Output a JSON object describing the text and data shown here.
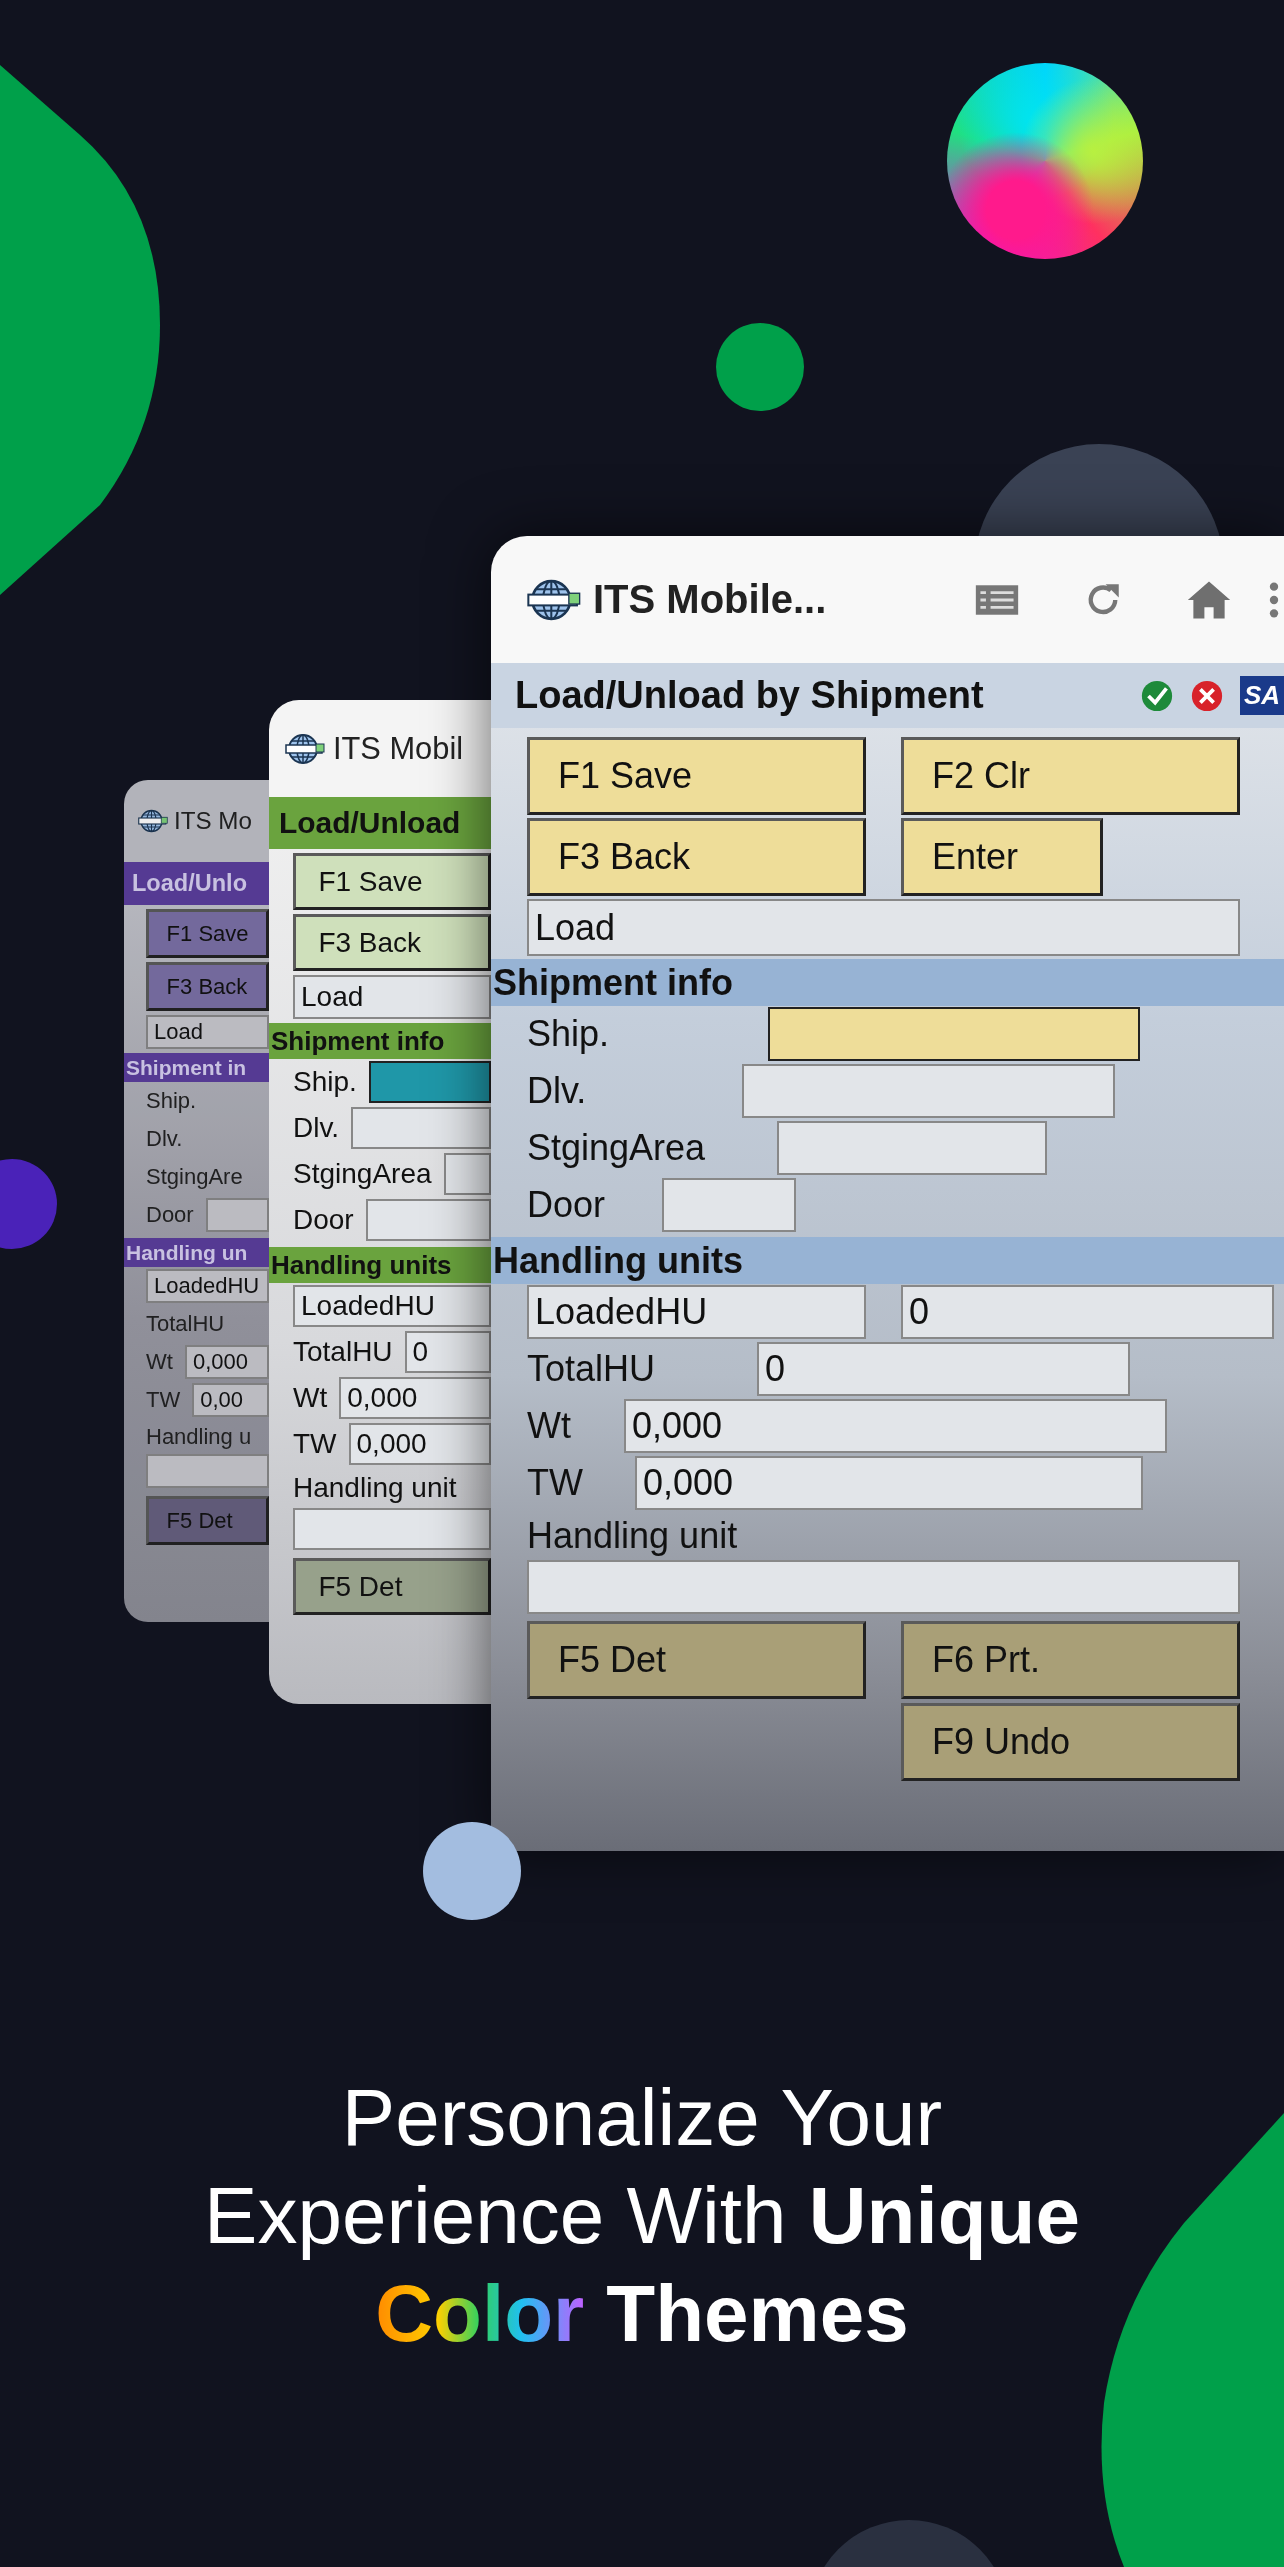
{
  "screens": [
    {
      "kind": "violet",
      "app_title": "ITS Mo",
      "title": "Load/Unlo",
      "color": "#5b3e9c",
      "buttons": [
        [
          "F1 Save"
        ],
        [
          "F3 Back"
        ]
      ],
      "mode_field": "Load",
      "sections": [
        {
          "heading": "Shipment in",
          "rows": [
            {
              "kind": "field",
              "label": "Ship."
            },
            {
              "kind": "field",
              "label": "Dlv."
            },
            {
              "kind": "field",
              "label": "StgingAre"
            },
            {
              "kind": "field",
              "label": "Door",
              "field": {
                "focused": false
              }
            }
          ]
        },
        {
          "heading": "Handling un",
          "rows": [
            {
              "kind": "boxed",
              "label": "LoadedHU"
            },
            {
              "kind": "field",
              "label": "TotalHU"
            },
            {
              "kind": "field",
              "label": "Wt",
              "field": {
                "value": "0,000",
                "focused": false
              }
            },
            {
              "kind": "field",
              "label": "TW",
              "field": {
                "value": "0,00",
                "focused": false
              }
            },
            {
              "kind": "stacked",
              "label": "Handling u",
              "field": {
                "focused": false
              }
            }
          ]
        }
      ],
      "footer_buttons": [
        [
          "F5 Det"
        ]
      ]
    },
    {
      "kind": "green",
      "app_title": "ITS Mobil",
      "title": "Load/Unload",
      "color": "#6aa33e",
      "buttons": [
        [
          "F1 Save"
        ],
        [
          "F3 Back"
        ]
      ],
      "mode_field": "Load",
      "sections": [
        {
          "heading": "Shipment info",
          "rows": [
            {
              "kind": "field",
              "label": "Ship.",
              "field": {
                "focused": true
              }
            },
            {
              "kind": "field",
              "label": "Dlv.",
              "field": {
                "focused": false
              }
            },
            {
              "kind": "field",
              "label": "StgingArea",
              "field": {
                "focused": false
              }
            },
            {
              "kind": "field",
              "label": "Door",
              "field": {
                "focused": false
              }
            }
          ]
        },
        {
          "heading": "Handling units",
          "rows": [
            {
              "kind": "boxed",
              "label": "LoadedHU"
            },
            {
              "kind": "field",
              "label": "TotalHU",
              "field": {
                "value": "0",
                "focused": false
              }
            },
            {
              "kind": "field",
              "label": "Wt",
              "field": {
                "value": "0,000",
                "focused": false
              }
            },
            {
              "kind": "field",
              "label": "TW",
              "field": {
                "value": "0,000",
                "focused": false
              }
            },
            {
              "kind": "stacked",
              "label": "Handling unit",
              "field": {
                "focused": false
              }
            }
          ]
        }
      ],
      "footer_buttons": [
        [
          "F5 Det"
        ]
      ]
    },
    {
      "kind": "classic",
      "app_title": "ITS Mobile...",
      "title": "Load/Unload by Shipment",
      "logo_text": "SA",
      "color": "#c9d4e2",
      "buttons": [
        [
          "F1 Save",
          "F2 Clr"
        ],
        [
          "F3 Back",
          "Enter"
        ]
      ],
      "mode_field": "Load",
      "sections": [
        {
          "heading": "Shipment info",
          "rows": [
            {
              "kind": "field",
              "label": "Ship.",
              "field": {
                "focused": true
              }
            },
            {
              "kind": "field",
              "label": "Dlv.",
              "field": {
                "focused": false
              }
            },
            {
              "kind": "field",
              "label": "StgingArea",
              "field": {
                "focused": false
              }
            },
            {
              "kind": "field",
              "label": "Door",
              "field": {
                "focused": false
              }
            }
          ]
        },
        {
          "heading": "Handling units",
          "rows": [
            {
              "kind": "boxed",
              "label": "LoadedHU",
              "field": {
                "value": "0",
                "focused": false
              }
            },
            {
              "kind": "field",
              "label": "TotalHU",
              "field": {
                "value": "0",
                "focused": false
              }
            },
            {
              "kind": "field",
              "label": "Wt",
              "field": {
                "value": "0,000",
                "focused": false
              }
            },
            {
              "kind": "field",
              "label": "TW",
              "field": {
                "value": "0,000",
                "focused": false
              }
            },
            {
              "kind": "stacked",
              "label": "Handling unit",
              "field": {
                "focused": false
              }
            }
          ]
        }
      ],
      "footer_buttons": [
        [
          "F5 Det",
          "F6 Prt."
        ],
        [
          "F9 Undo"
        ]
      ]
    }
  ],
  "headline": [
    [
      {
        "text": "Personalize Your",
        "kind": "regular"
      }
    ],
    [
      {
        "text": "Experience With ",
        "kind": "regular"
      },
      {
        "text": "Unique",
        "kind": "bold"
      }
    ],
    [
      {
        "text": "Color",
        "kind": "rainbow"
      },
      {
        "text": " Themes",
        "kind": "bold"
      }
    ]
  ]
}
